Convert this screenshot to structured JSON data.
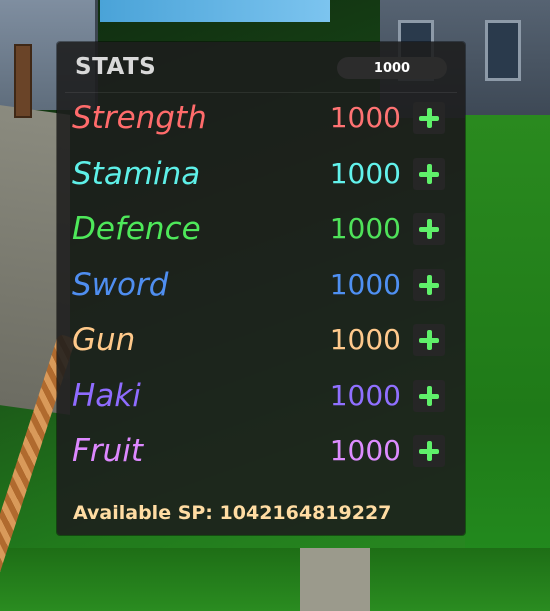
{
  "panel": {
    "title": "STATS",
    "points_input_value": "1000",
    "available_sp_label": "Available SP:",
    "available_sp_value": "1042164819227"
  },
  "stats": [
    {
      "name": "Strength",
      "value": "1000",
      "color": "#ff6b6b",
      "value_color": "#ff7373"
    },
    {
      "name": "Stamina",
      "value": "1000",
      "color": "#5ef0e8",
      "value_color": "#62f2ec"
    },
    {
      "name": "Defence",
      "value": "1000",
      "color": "#4ee85a",
      "value_color": "#4fe25a"
    },
    {
      "name": "Sword",
      "value": "1000",
      "color": "#4f8ef0",
      "value_color": "#4f90f2"
    },
    {
      "name": "Gun",
      "value": "1000",
      "color": "#ffc98a",
      "value_color": "#ffc98c"
    },
    {
      "name": "Haki",
      "value": "1000",
      "color": "#8f6cff",
      "value_color": "#9070ff"
    },
    {
      "name": "Fruit",
      "value": "1000",
      "color": "#dd88ff",
      "value_color": "#dd8cff"
    }
  ],
  "icons": {
    "add": "plus-icon"
  }
}
